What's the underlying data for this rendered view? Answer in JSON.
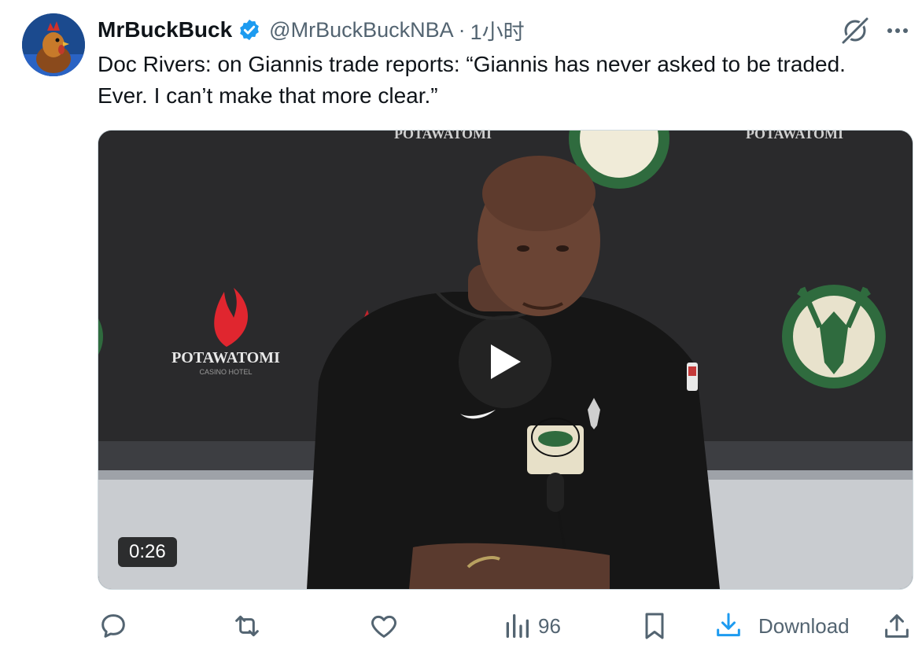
{
  "tweet": {
    "author_name": "MrBuckBuck",
    "author_handle": "@MrBuckBuckNBA",
    "separator": "·",
    "timestamp": "1小时",
    "text": "Doc Rivers: on Giannis trade reports: “Giannis has never asked to be traded. Ever. I can’t make that more clear.”",
    "verified": true
  },
  "media": {
    "duration": "0:26",
    "backdrop_sponsor": "POTAWATOMI",
    "backdrop_sponsor_sub": "CASINO HOTEL",
    "team_badge_text": "MILWAUKEE BUCKS"
  },
  "actions": {
    "views": "96",
    "download_label": "Download"
  },
  "colors": {
    "text_primary": "#0f1419",
    "text_secondary": "#536471",
    "verified_blue": "#1d9bf0",
    "bucks_green": "#2f6b3e"
  },
  "icons": [
    "grok-icon",
    "more-icon",
    "reply-icon",
    "retweet-icon",
    "like-icon",
    "views-icon",
    "bookmark-icon",
    "download-icon",
    "share-icon",
    "play-icon",
    "verified-icon"
  ]
}
